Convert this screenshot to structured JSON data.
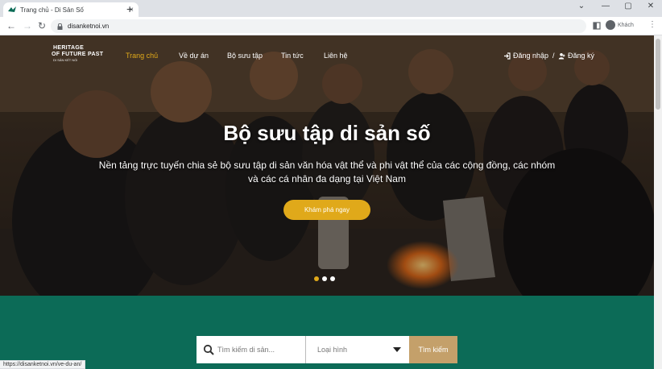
{
  "browser": {
    "tab_title": "Trang chủ - Di Sản Số",
    "tab_close": "×",
    "new_tab": "+",
    "url": "disanketnoi.vn",
    "profile_name": "Khách",
    "status_url": "https://disanketnoi.vn/ve-du-an/",
    "controls": {
      "chevron": "⌄",
      "minimize": "—",
      "maximize": "▢",
      "close": "✕"
    },
    "nav": {
      "back": "←",
      "forward": "→",
      "reload": "↻",
      "menu": "⋮"
    }
  },
  "site": {
    "logo": {
      "line1": "HERITAGE",
      "line2": "OF FUTURE PAST",
      "sub": "DI SẢN KẾT NỐI"
    },
    "nav": [
      "Trang chủ",
      "Về dự án",
      "Bộ sưu tập",
      "Tin tức",
      "Liên hệ"
    ],
    "login": "Đăng nhập",
    "separator": "/",
    "register": "Đăng ký"
  },
  "hero": {
    "title": "Bộ sưu tập di sản số",
    "subtitle": "Nền tảng trực tuyến chia sẻ bộ sưu tập di sản văn hóa vật thể và phi vật thể của các cộng đồng, các nhóm và các cá nhân đa dạng tại Việt Nam",
    "cta": "Khám phá ngay",
    "slides": 3,
    "active_slide": 1
  },
  "search": {
    "placeholder": "Tìm kiếm di sản...",
    "type_label": "Loại hình",
    "button": "Tìm kiếm"
  },
  "colors": {
    "accent": "#e0a91a",
    "band": "#0c6b57",
    "button": "#c4a06a"
  }
}
